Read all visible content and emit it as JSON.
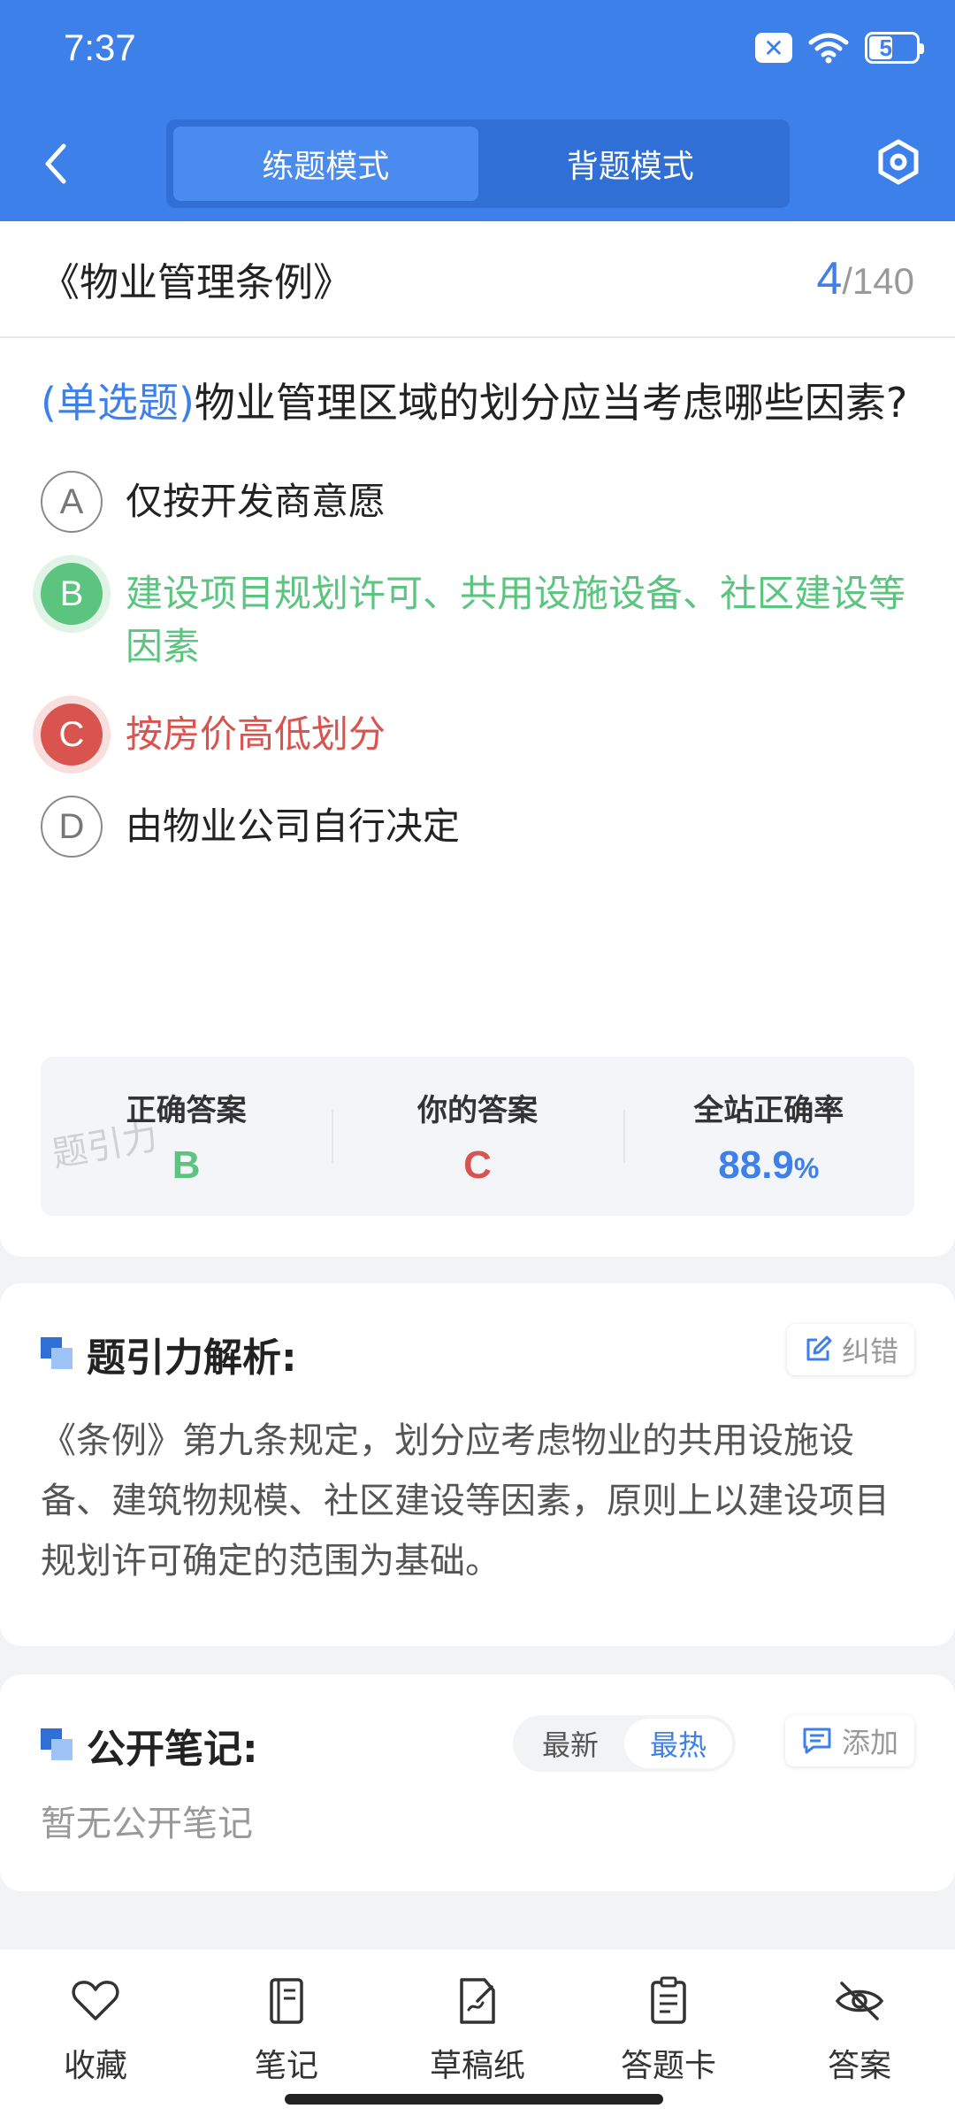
{
  "status_bar": {
    "time": "7:37",
    "battery": "50"
  },
  "header": {
    "tabs": [
      {
        "label": "练题模式",
        "active": true
      },
      {
        "label": "背题模式",
        "active": false
      }
    ],
    "icons": {
      "back": "chevron-left-icon",
      "settings": "hexagon-gear-icon"
    }
  },
  "title_bar": {
    "book_title": "《物业管理条例》",
    "current": "4",
    "separator": "/",
    "total": "140"
  },
  "question": {
    "type_label": "(单选题)",
    "text": "物业管理区域的划分应当考虑哪些因素?",
    "options": [
      {
        "letter": "A",
        "text": "仅按开发商意愿",
        "state": "normal"
      },
      {
        "letter": "B",
        "text": "建设项目规划许可、共用设施设备、社区建设等因素",
        "state": "correct"
      },
      {
        "letter": "C",
        "text": "按房价高低划分",
        "state": "wrong"
      },
      {
        "letter": "D",
        "text": "由物业公司自行决定",
        "state": "normal"
      }
    ]
  },
  "answer_summary": {
    "correct_label": "正确答案",
    "correct_value": "B",
    "yours_label": "你的答案",
    "yours_value": "C",
    "rate_label": "全站正确率",
    "rate_value": "88.9",
    "rate_unit": "%"
  },
  "watermark": "题引力",
  "analysis": {
    "title": "题引力解析:",
    "report_label": "纠错",
    "text": "《条例》第九条规定，划分应考虑物业的共用设施设备、建筑物规模、社区建设等因素，原则上以建设项目规划许可确定的范围为基础。"
  },
  "notes": {
    "title": "公开笔记:",
    "sort_options": [
      {
        "label": "最新",
        "active": false
      },
      {
        "label": "最热",
        "active": true
      }
    ],
    "add_label": "添加",
    "empty_text": "暂无公开笔记"
  },
  "bottom_bar": [
    {
      "label": "收藏",
      "icon": "heart-icon"
    },
    {
      "label": "笔记",
      "icon": "notebook-icon"
    },
    {
      "label": "草稿纸",
      "icon": "draft-paper-icon"
    },
    {
      "label": "答题卡",
      "icon": "answer-sheet-icon"
    },
    {
      "label": "答案",
      "icon": "eye-off-icon"
    }
  ],
  "colors": {
    "primary": "#3e80ea",
    "correct": "#5bc47f",
    "wrong": "#d9534f"
  }
}
